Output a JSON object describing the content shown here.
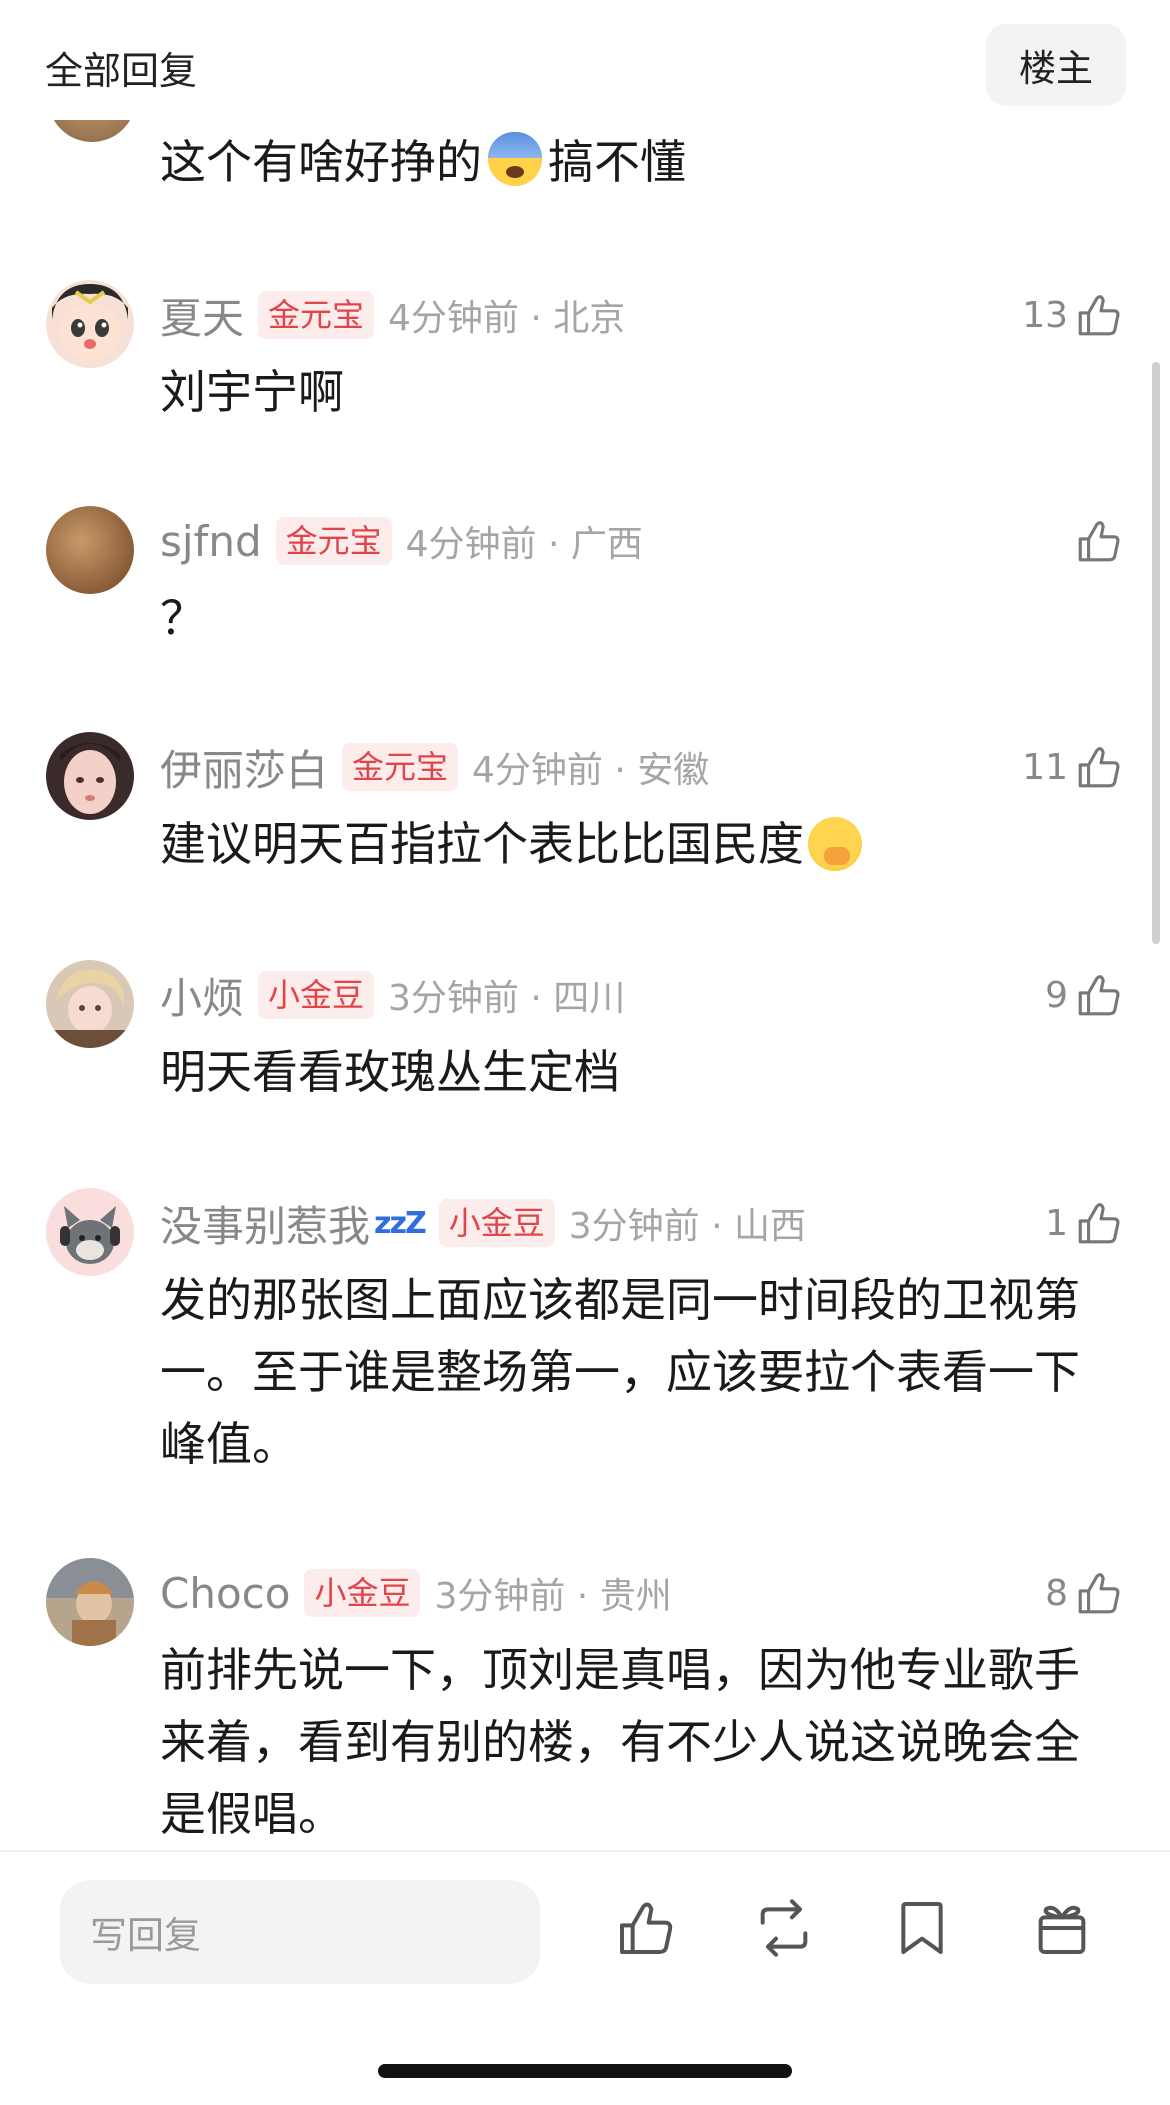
{
  "header": {
    "title": "全部回复",
    "owner_button": "楼主"
  },
  "top_comment": {
    "text_before": "这个有啥好挣的",
    "emoji": "anxious-face-emoji",
    "text_after": "搞不懂"
  },
  "comments": [
    {
      "username": "夏天",
      "badge": "金元宝",
      "time": "4分钟前 · 北京",
      "likes": "13",
      "text": "刘宇宁啊",
      "avatar": "anime-face-avatar"
    },
    {
      "username": "sjfnd",
      "badge": "金元宝",
      "time": "4分钟前 · 广西",
      "likes": "",
      "text": "？",
      "avatar": "texture-avatar"
    },
    {
      "username": "伊丽莎白",
      "badge": "金元宝",
      "time": "4分钟前 · 安徽",
      "likes": "11",
      "text": "建议明天百指拉个表比比国民度",
      "emoji": "face-with-hand-over-mouth-emoji",
      "avatar": "girl-photo-avatar"
    },
    {
      "username": "小烦",
      "badge": "小金豆",
      "time": "3分钟前 · 四川",
      "likes": "9",
      "text": "明天看看玫瑰丛生定档",
      "avatar": "doll-photo-avatar"
    },
    {
      "username": "没事别惹我",
      "username_suffix": "zzZ",
      "badge": "小金豆",
      "time": "3分钟前 · 山西",
      "likes": "1",
      "text": "发的那张图上面应该都是同一时间段的卫视第一。至于谁是整场第一，应该要拉个表看一下峰值。",
      "avatar": "cartoon-cat-avatar"
    },
    {
      "username": "Choco",
      "badge": "小金豆",
      "time": "3分钟前 · 贵州",
      "likes": "8",
      "text": "前排先说一下，顶刘是真唱，因为他专业歌手来着，看到有别的楼，有不少人说这说晚会全是假唱。",
      "avatar": "photo-avatar"
    }
  ],
  "footer": {
    "reply_placeholder": "写回复",
    "icons": [
      "like-icon",
      "repost-icon",
      "bookmark-icon",
      "gift-icon"
    ]
  },
  "colors": {
    "badge_text": "#e0454a",
    "badge_bg": "#fdecec",
    "meta_gray": "#a5a5a5"
  }
}
